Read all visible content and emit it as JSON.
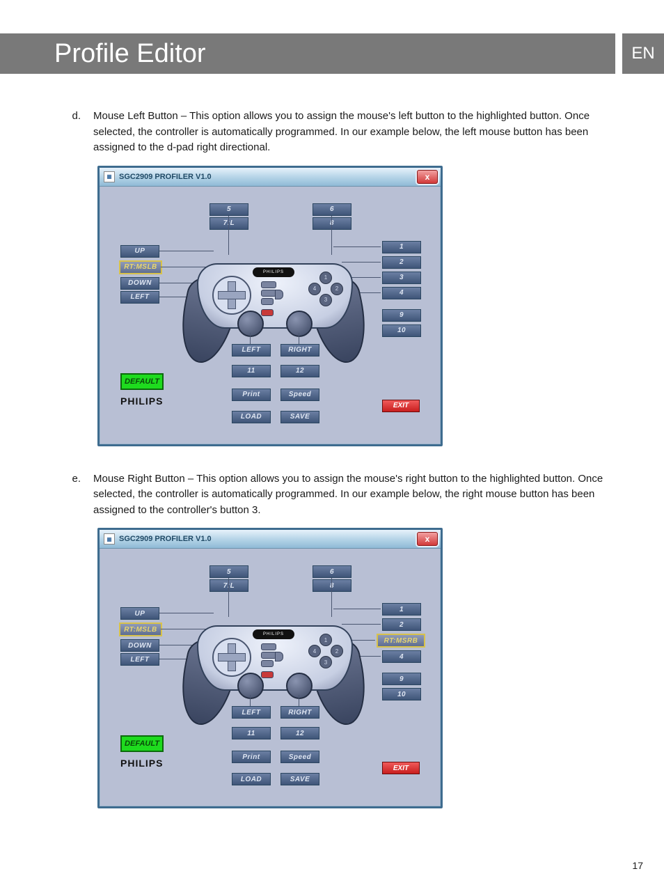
{
  "header": {
    "title": "Profile Editor",
    "lang": "EN"
  },
  "page_number": "17",
  "paragraphs": {
    "d": {
      "marker": "d.",
      "text": "Mouse Left Button – This option allows you to assign the mouse's left button to the highlighted button. Once selected, the controller is automatically programmed. In our example below, the left mouse button has been assigned to the d-pad right directional."
    },
    "e": {
      "marker": "e.",
      "text": "Mouse Right Button – This option allows you to assign the mouse's right button to the highlighted button. Once selected, the controller is automatically programmed. In our example below, the right mouse button has been assigned to the controller's button 3."
    }
  },
  "window": {
    "title": "SGC2909 PROFILER V1.0",
    "close": "x",
    "brand": "PHILIPS",
    "default": "DEFAULT",
    "exit": "EXIT",
    "top": {
      "b5": "5",
      "b6": "6",
      "b7": "7:L",
      "b8": "8"
    },
    "dpad": {
      "up": "UP",
      "right_hl": "RT:MSLB",
      "down": "DOWN",
      "left": "LEFT"
    },
    "face": {
      "b1": "1",
      "b2": "2",
      "b3": "3",
      "b4": "4",
      "b9": "9",
      "b10": "10"
    },
    "face2": {
      "b1": "1",
      "b2": "2",
      "b3_hl": "RT:MSRB",
      "b4": "4",
      "b9": "9",
      "b10": "10"
    },
    "sticks": {
      "left": "LEFT",
      "right": "RIGHT",
      "b11": "11",
      "b12": "12"
    },
    "util": {
      "print": "Print",
      "speed": "Speed",
      "load": "LOAD",
      "save": "SAVE"
    }
  }
}
